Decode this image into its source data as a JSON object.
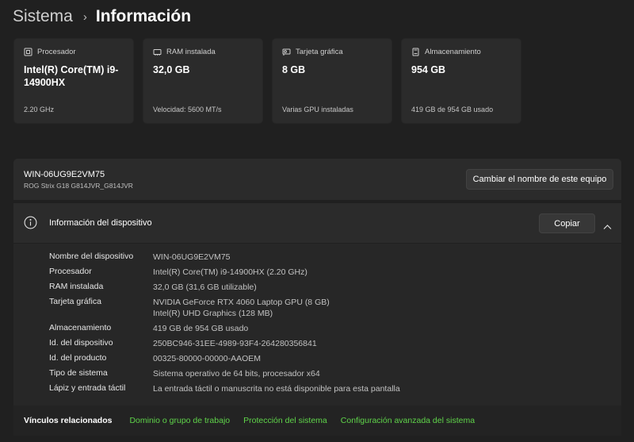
{
  "breadcrumb": {
    "parent": "Sistema",
    "separator": "›",
    "current": "Información"
  },
  "cards": [
    {
      "icon": "processor-icon",
      "label": "Procesador",
      "value": "Intel(R) Core(TM) i9-14900HX",
      "sub": "2.20 GHz"
    },
    {
      "icon": "ram-icon",
      "label": "RAM instalada",
      "value": "32,0 GB",
      "sub": "Velocidad: 5600 MT/s"
    },
    {
      "icon": "graphics-card-icon",
      "label": "Tarjeta gráfica",
      "value": "8 GB",
      "sub": "Varias GPU instaladas"
    },
    {
      "icon": "storage-icon",
      "label": "Almacenamiento",
      "value": "954 GB",
      "sub": "419 GB de 954 GB usado"
    }
  ],
  "device": {
    "name": "WIN-06UG9E2VM75",
    "model": "ROG Strix G18 G814JVR_G814JVR",
    "rename_label": "Cambiar el nombre de este equipo"
  },
  "device_info": {
    "title": "Información del dispositivo",
    "copy_label": "Copiar",
    "specs": [
      {
        "label": "Nombre del dispositivo",
        "value": "WIN-06UG9E2VM75"
      },
      {
        "label": "Procesador",
        "value": "Intel(R) Core(TM) i9-14900HX (2.20 GHz)"
      },
      {
        "label": "RAM instalada",
        "value": "32,0 GB (31,6 GB utilizable)"
      },
      {
        "label": "Tarjeta gráfica",
        "value": "NVIDIA GeForce RTX 4060 Laptop GPU (8 GB)",
        "value2": "Intel(R) UHD Graphics (128 MB)"
      },
      {
        "label": "Almacenamiento",
        "value": "419 GB de 954 GB usado"
      },
      {
        "label": "Id. del dispositivo",
        "value": "250BC946-31EE-4989-93F4-264280356841"
      },
      {
        "label": "Id. del producto",
        "value": "00325-80000-00000-AAOEM"
      },
      {
        "label": "Tipo de sistema",
        "value": "Sistema operativo de 64 bits, procesador x64"
      },
      {
        "label": "Lápiz y entrada táctil",
        "value": "La entrada táctil o manuscrita no está disponible para esta pantalla"
      }
    ]
  },
  "related": {
    "label": "Vínculos relacionados",
    "links": [
      "Dominio o grupo de trabajo",
      "Protección del sistema",
      "Configuración avanzada del sistema"
    ]
  },
  "colors": {
    "background": "#202020",
    "panel": "#2b2b2b",
    "link": "#5fd44a"
  }
}
